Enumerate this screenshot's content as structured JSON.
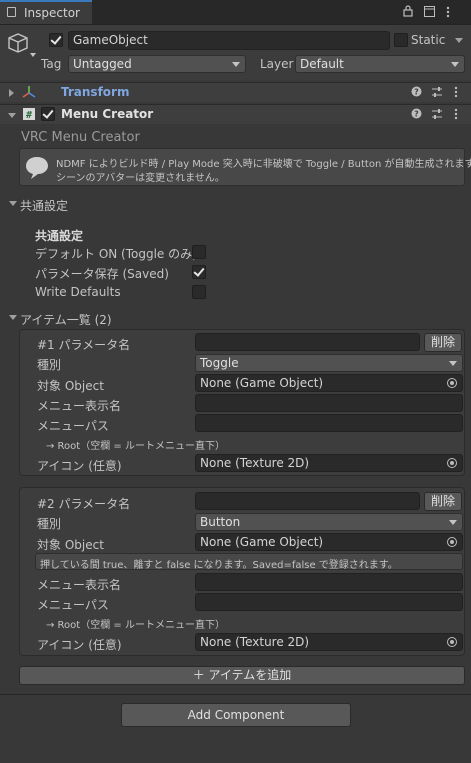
{
  "tab": {
    "title": "Inspector",
    "lock_icon": "lock-icon",
    "maximize_icon": "maximize-icon",
    "menu_icon": "kebab-menu-icon"
  },
  "gameobject": {
    "name": "GameObject",
    "active": true,
    "static_label": "Static",
    "static": false,
    "tag_label": "Tag",
    "tag_value": "Untagged",
    "layer_label": "Layer",
    "layer_value": "Default"
  },
  "components": [
    {
      "name": "Transform",
      "expanded": false,
      "icon": "transform-icon"
    },
    {
      "name": "Menu Creator",
      "expanded": true,
      "icon": "script-icon",
      "enabled": true
    }
  ],
  "menu_creator": {
    "title": "VRC Menu Creator",
    "info_line1": "NDMF によりビルド時 / Play Mode 突入時に非破壊で Toggle / Button が自動生成されます。",
    "info_line2": "シーンのアバターは変更されません。",
    "common_foldout": "共通設定",
    "common_header": "共通設定",
    "default_on_label": "デフォルト ON (Toggle のみ)",
    "default_on": false,
    "param_saved_label": "パラメータ保存 (Saved)",
    "param_saved": true,
    "write_defaults_label": "Write Defaults",
    "write_defaults": false,
    "items_foldout": "アイテム一覧 (2)",
    "items": [
      {
        "param_label": "#1 パラメータ名",
        "param_value": "",
        "delete_label": "削除",
        "type_label": "種別",
        "type_value": "Toggle",
        "target_label": "対象 Object",
        "target_value": "None (Game Object)",
        "hint": "",
        "menu_name_label": "メニュー表示名",
        "menu_name_value": "",
        "menu_path_label": "メニューパス",
        "menu_path_value": "",
        "root_note": "→ Root（空欄 = ルートメニュー直下）",
        "icon_label": "アイコン (任意)",
        "icon_value": "None (Texture 2D)"
      },
      {
        "param_label": "#2 パラメータ名",
        "param_value": "",
        "delete_label": "削除",
        "type_label": "種別",
        "type_value": "Button",
        "target_label": "対象 Object",
        "target_value": "None (Game Object)",
        "hint": "押している間 true、離すと false になります。Saved=false で登録されます。",
        "menu_name_label": "メニュー表示名",
        "menu_name_value": "",
        "menu_path_label": "メニューパス",
        "menu_path_value": "",
        "root_note": "→ Root（空欄 = ルートメニュー直下）",
        "icon_label": "アイコン (任意)",
        "icon_value": "None (Texture 2D)"
      }
    ],
    "add_item_label": "＋ アイテムを追加"
  },
  "add_component_label": "Add Component"
}
